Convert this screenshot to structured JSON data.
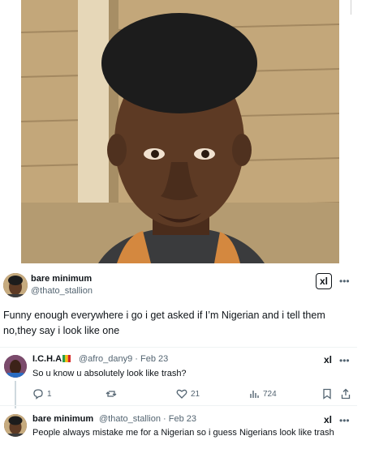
{
  "main_post": {
    "name": "bare minimum",
    "handle": "@thato_stallion",
    "badge_glyph": "xl",
    "more_glyph": "•••",
    "text": "Funny enough everywhere i go i get asked if I’m Nigerian and i tell them no,they say i look like one"
  },
  "reply_1": {
    "name": "I.C.H.A",
    "handle_date": "@afro_dany9 · Feb 23",
    "text": "So u know u absolutely look like trash?",
    "badge_glyph": "xl",
    "more_glyph": "•••",
    "actions": {
      "replies": "1",
      "reposts": "",
      "likes": "21",
      "views": "724"
    }
  },
  "reply_2": {
    "name": "bare minimum",
    "handle_date": "@thato_stallion · Feb 23",
    "text": "People always mistake me for a Nigerian so i guess Nigerians look like trash",
    "badge_glyph": "xl",
    "more_glyph": "•••"
  },
  "icons": [
    "reply-icon",
    "repost-icon",
    "like-icon",
    "views-icon",
    "bookmark-icon",
    "share-icon",
    "grok-x-icon",
    "more-icon"
  ],
  "colors": {
    "text": "#0f1419",
    "muted": "#536471",
    "divider": "#eff3f4"
  }
}
